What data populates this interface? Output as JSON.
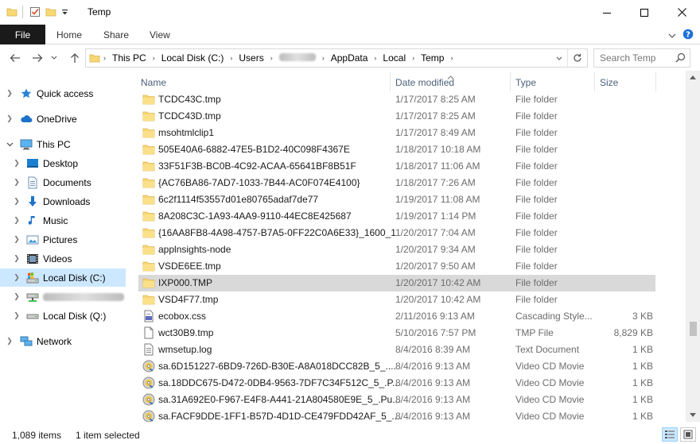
{
  "window": {
    "title": "Temp",
    "minimize": "—",
    "maximize": "☐",
    "close": "✕"
  },
  "ribbon": {
    "tabs": [
      "File",
      "Home",
      "Share",
      "View"
    ],
    "help": "?"
  },
  "address": {
    "crumbs": [
      "This PC",
      "Local Disk (C:)",
      "Users",
      "AppData",
      "Local",
      "Temp"
    ]
  },
  "search": {
    "placeholder": "Search Temp"
  },
  "nav": {
    "quick_access": "Quick access",
    "onedrive": "OneDrive",
    "this_pc": "This PC",
    "desktop": "Desktop",
    "documents": "Documents",
    "downloads": "Downloads",
    "music": "Music",
    "pictures": "Pictures",
    "videos": "Videos",
    "local_disk_c": "Local Disk (C:)",
    "local_disk_q": "Local Disk (Q:)",
    "network": "Network"
  },
  "columns": {
    "name": "Name",
    "date": "Date modified",
    "type": "Type",
    "size": "Size"
  },
  "files": [
    {
      "name": "TCDC43C.tmp",
      "date": "1/17/2017 8:25 AM",
      "type": "File folder",
      "size": "",
      "icon": "folder-icon"
    },
    {
      "name": "TCDC43D.tmp",
      "date": "1/17/2017 8:25 AM",
      "type": "File folder",
      "size": "",
      "icon": "folder-icon"
    },
    {
      "name": "msohtmlclip1",
      "date": "1/17/2017 8:49 AM",
      "type": "File folder",
      "size": "",
      "icon": "folder-icon"
    },
    {
      "name": "505E40A6-6882-47E5-B1D2-40C098F4367E",
      "date": "1/18/2017 10:18 AM",
      "type": "File folder",
      "size": "",
      "icon": "folder-icon"
    },
    {
      "name": "33F51F3B-BC0B-4C92-ACAA-65641BF8B51F",
      "date": "1/18/2017 11:06 AM",
      "type": "File folder",
      "size": "",
      "icon": "folder-icon"
    },
    {
      "name": "{AC76BA86-7AD7-1033-7B44-AC0F074E4100}",
      "date": "1/18/2017 7:26 AM",
      "type": "File folder",
      "size": "",
      "icon": "folder-icon"
    },
    {
      "name": "6c2f1114f53557d01e80765adaf7de77",
      "date": "1/19/2017 11:08 AM",
      "type": "File folder",
      "size": "",
      "icon": "folder-icon"
    },
    {
      "name": "8A208C3C-1A93-4AA9-9110-44EC8E425687",
      "date": "1/19/2017 1:14 PM",
      "type": "File folder",
      "size": "",
      "icon": "folder-icon"
    },
    {
      "name": "{16AA8FB8-4A98-4757-B7A5-0FF22C0A6E33}_1600_1",
      "date": "1/20/2017 7:04 AM",
      "type": "File folder",
      "size": "",
      "icon": "folder-icon"
    },
    {
      "name": "applnsights-node",
      "date": "1/20/2017 9:34 AM",
      "type": "File folder",
      "size": "",
      "icon": "folder-icon"
    },
    {
      "name": "VSDE6EE.tmp",
      "date": "1/20/2017 9:50 AM",
      "type": "File folder",
      "size": "",
      "icon": "folder-icon"
    },
    {
      "name": "IXP000.TMP",
      "date": "1/20/2017 10:42 AM",
      "type": "File folder",
      "size": "",
      "icon": "folder-icon",
      "selected": true
    },
    {
      "name": "VSD4F77.tmp",
      "date": "1/20/2017 10:42 AM",
      "type": "File folder",
      "size": "",
      "icon": "folder-icon"
    },
    {
      "name": "ecobox.css",
      "date": "2/11/2016 9:13 AM",
      "type": "Cascading Style...",
      "size": "3 KB",
      "icon": "css-file-icon"
    },
    {
      "name": "wct30B9.tmp",
      "date": "5/10/2016 7:57 PM",
      "type": "TMP File",
      "size": "8,829 KB",
      "icon": "blank-file-icon"
    },
    {
      "name": "wmsetup.log",
      "date": "8/4/2016 8:39 AM",
      "type": "Text Document",
      "size": "1 KB",
      "icon": "text-file-icon"
    },
    {
      "name": "sa.6D151227-6BD9-726D-B30E-A8A018DCC82B_5_....",
      "date": "8/4/2016 9:13 AM",
      "type": "Video CD Movie",
      "size": "1 KB",
      "icon": "video-cd-icon"
    },
    {
      "name": "sa.18DDC675-D472-0DB4-9563-7DF7C34F512C_5_.P...",
      "date": "8/4/2016 9:13 AM",
      "type": "Video CD Movie",
      "size": "1 KB",
      "icon": "video-cd-icon"
    },
    {
      "name": "sa.31A692E0-F967-E4F8-A441-21A804580E9E_5_.Pu...",
      "date": "8/4/2016 9:13 AM",
      "type": "Video CD Movie",
      "size": "1 KB",
      "icon": "video-cd-icon"
    },
    {
      "name": "sa.FACF9DDE-1FF1-B57D-4D1D-CE479FDD42AF_5_....",
      "date": "8/4/2016 9:13 AM",
      "type": "Video CD Movie",
      "size": "1 KB",
      "icon": "video-cd-icon"
    }
  ],
  "status": {
    "count": "1,089 items",
    "selected": "1 item selected"
  }
}
